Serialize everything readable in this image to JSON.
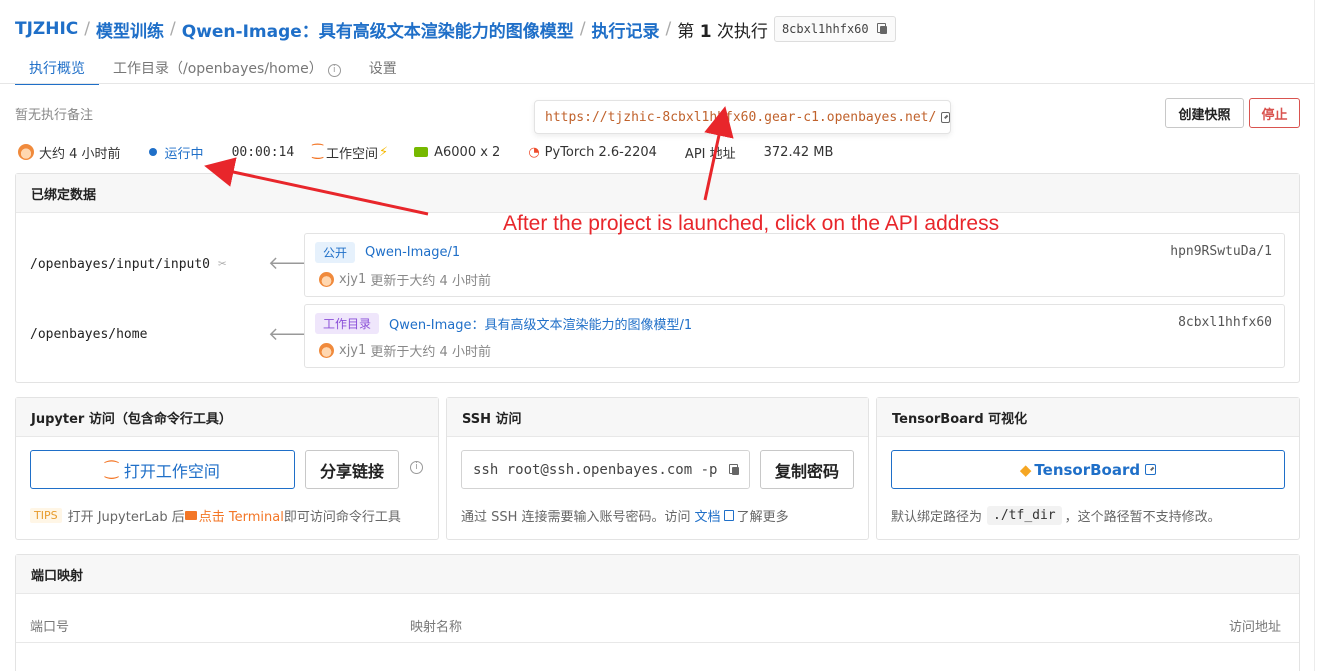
{
  "breadcrumb": {
    "org": "TJZHIC",
    "section": "模型训练",
    "project": "Qwen-Image：具有高级文本渲染能力的图像模型",
    "records": "执行记录",
    "run_prefix": "第",
    "run_number": "1",
    "run_suffix": "次执行",
    "run_id": "8cbxl1hhfx60"
  },
  "tabs": [
    {
      "label": "执行概览",
      "active": true
    },
    {
      "label": "工作目录（/openbayes/home）",
      "active": false
    },
    {
      "label": "设置",
      "active": false
    }
  ],
  "note": "暂无执行备注",
  "actions": {
    "snapshot": "创建快照",
    "stop": "停止"
  },
  "tooltip": {
    "url": "https://tjzhic-8cbxl1hhfx60.gear-c1.openbayes.net/"
  },
  "status": {
    "time_ago": "大约 4 小时前",
    "state": "运行中",
    "duration": "00:00:14",
    "workspace": "工作空间",
    "gpu": "A6000 x 2",
    "framework": "PyTorch 2.6-2204",
    "api": "API 地址",
    "size": "372.42 MB"
  },
  "bound_data": {
    "title": "已绑定数据",
    "items": [
      {
        "path": "/openbayes/input/input0",
        "badge": "公开",
        "name": "Qwen-Image/1",
        "id": "hpn9RSwtuDa/1",
        "user": "xjy1",
        "updated": "更新于大约 4 小时前"
      },
      {
        "path": "/openbayes/home",
        "badge": "工作目录",
        "name": "Qwen-Image：具有高级文本渲染能力的图像模型/1",
        "id": "8cbxl1hhfx60",
        "user": "xjy1",
        "updated": "更新于大约 4 小时前"
      }
    ]
  },
  "jupyter": {
    "title": "Jupyter 访问（包含命令行工具）",
    "open_button": "打开工作空间",
    "share_button": "分享链接",
    "tips_badge": "TIPS",
    "tips_before": "打开 JupyterLab 后",
    "tips_terminal": "点击 Terminal",
    "tips_after": "即可访问命令行工具"
  },
  "ssh": {
    "title": "SSH 访问",
    "command": "ssh root@ssh.openbayes.com -p",
    "copy_password": "复制密码",
    "help_before": "通过 SSH 连接需要输入账号密码。访问",
    "help_link": "文档",
    "help_after": "了解更多"
  },
  "tensorboard": {
    "title": "TensorBoard 可视化",
    "button": "TensorBoard",
    "help_before": "默认绑定路径为",
    "help_path": "./tf_dir",
    "help_after": "，这个路径暂不支持修改。"
  },
  "ports": {
    "title": "端口映射",
    "columns": [
      "端口号",
      "映射名称",
      "访问地址"
    ]
  },
  "annotation": {
    "text": "After the project is launched, click on the API address",
    "color": "#e8262b"
  }
}
